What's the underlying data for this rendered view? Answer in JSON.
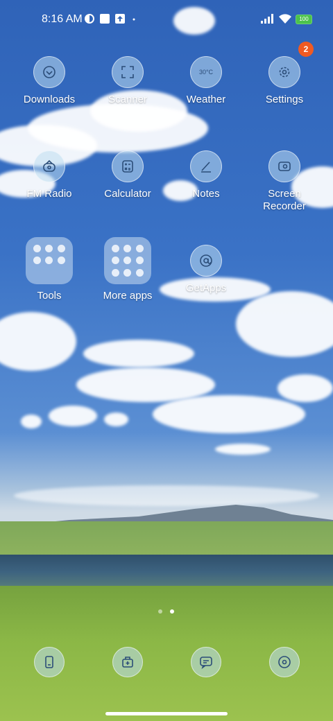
{
  "status_bar": {
    "time": "8:16 AM",
    "battery": "100",
    "icons": [
      "dnd-icon",
      "stop-icon",
      "upload-icon",
      "dot-icon",
      "signal-icon",
      "wifi-icon",
      "battery-icon"
    ]
  },
  "apps": [
    {
      "label": "Downloads",
      "icon": "download-icon"
    },
    {
      "label": "Scanner",
      "icon": "scanner-icon"
    },
    {
      "label": "Weather",
      "icon": "weather-icon",
      "icon_text": "30°C"
    },
    {
      "label": "Settings",
      "icon": "gear-icon",
      "badge": "2"
    },
    {
      "label": "FM Radio",
      "icon": "radio-icon"
    },
    {
      "label": "Calculator",
      "icon": "calculator-icon"
    },
    {
      "label": "Notes",
      "icon": "notes-icon"
    },
    {
      "label": "Screen Recorder",
      "icon": "screen-recorder-icon"
    },
    {
      "label": "Tools",
      "icon": "folder-icon"
    },
    {
      "label": "More apps",
      "icon": "folder-icon"
    },
    {
      "label": "GetApps",
      "icon": "getapps-icon"
    }
  ],
  "dock": [
    {
      "icon": "phone-icon"
    },
    {
      "icon": "toolbox-icon"
    },
    {
      "icon": "messages-icon"
    },
    {
      "icon": "music-disc-icon"
    }
  ],
  "page_indicator": {
    "pages": 2,
    "current": 2
  },
  "colors": {
    "accent_badge": "#f05a22",
    "battery_fill": "#4cc24c"
  }
}
